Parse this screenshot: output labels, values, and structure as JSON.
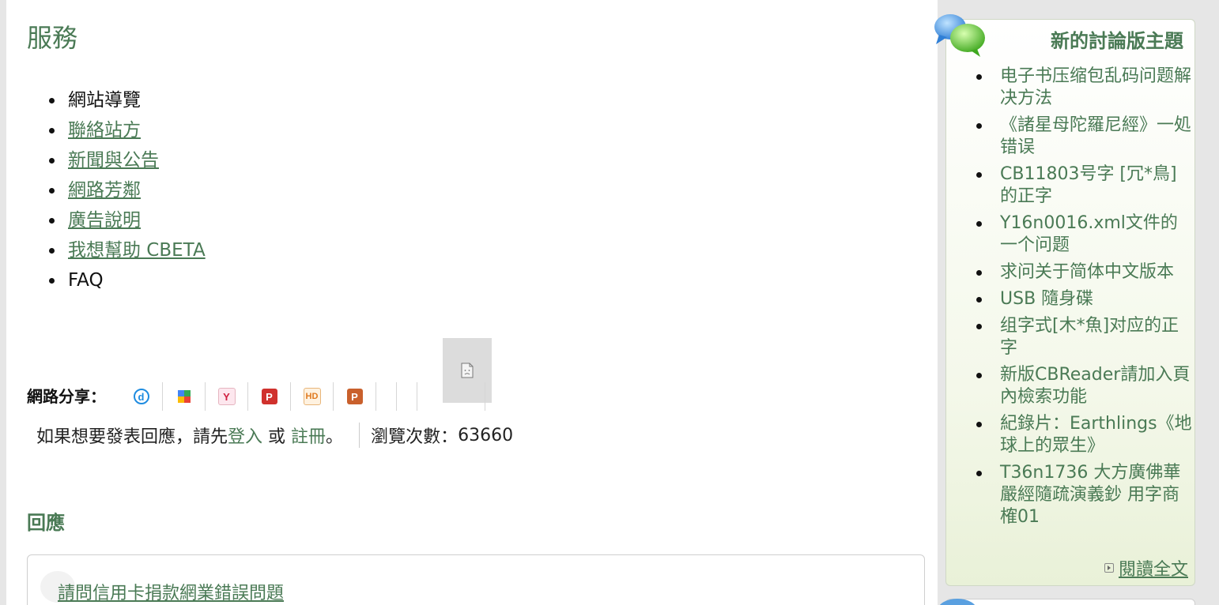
{
  "services": {
    "title": "服務",
    "items": [
      {
        "label": "網站導覽",
        "link": false
      },
      {
        "label": "聯絡站方",
        "link": true
      },
      {
        "label": "新聞與公告",
        "link": true
      },
      {
        "label": "網路芳鄰",
        "link": true
      },
      {
        "label": "廣告說明",
        "link": true
      },
      {
        "label": "我想幫助 CBETA",
        "link": true
      },
      {
        "label": "FAQ",
        "link": false
      }
    ]
  },
  "share": {
    "label": "網路分享：",
    "buttons": [
      {
        "icon": "d-icon",
        "glyph": "d",
        "color": "#1f8ce0"
      },
      {
        "icon": "google-bookmark-icon",
        "glyph": "",
        "color": "#4285f4"
      },
      {
        "icon": "yahoo-icon",
        "glyph": "Y",
        "color": "#f0a0b0"
      },
      {
        "icon": "plurk-icon",
        "glyph": "P",
        "color": "#d0312d"
      },
      {
        "icon": "hemidemi-icon",
        "glyph": "HD",
        "color": "#e07a1f"
      },
      {
        "icon": "funp-icon",
        "glyph": "P",
        "color": "#c9602c"
      },
      {
        "icon": "blank-icon",
        "glyph": "",
        "color": "transparent"
      },
      {
        "icon": "blank-icon",
        "glyph": "",
        "color": "transparent"
      }
    ]
  },
  "reply_bar": {
    "prefix": "如果想要發表回應，請先",
    "login": "登入",
    "or": " 或 ",
    "register": "註冊",
    "suffix": "。",
    "views_label": "瀏覽次數：",
    "views_count": "63660"
  },
  "responses": {
    "title": "回應",
    "first_title": "請問信用卡捐款網業錯誤問題"
  },
  "sidebar": {
    "title": "新的討論版主題",
    "topics": [
      "电子书压缩包乱码问题解决方法",
      "《諸星母陀羅尼經》一処错误",
      "CB11803号字 [冗*鳥] 的正字",
      "Y16n0016.xml文件的一个问题",
      "求问关于简体中文版本",
      "USB 隨身碟",
      "组字式[木*魚]对应的正字",
      "新版CBReader請加入頁內檢索功能",
      "紀錄片：Earthlings《地球上的眾生》",
      "T36n1736 大方廣佛華嚴經隨疏演義鈔 用字商榷01"
    ],
    "read_more": "閱讀全文"
  },
  "colors": {
    "accent_green": "#4a7a55",
    "page_bg": "#e6e6e6"
  }
}
